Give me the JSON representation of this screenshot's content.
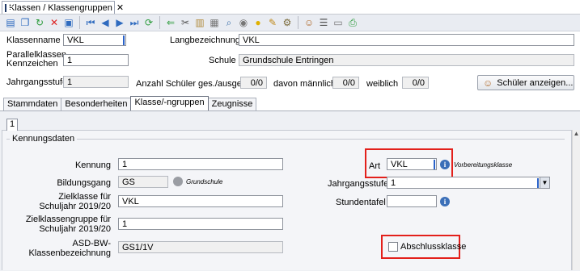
{
  "window_tab": {
    "title": "Klassen / Klassengruppen",
    "close": "✕"
  },
  "toolbar": {
    "icons": [
      "new-icon",
      "copy-icon",
      "refresh-icon",
      "delete-icon",
      "save-icon",
      "first-icon",
      "prev-icon",
      "next-icon",
      "last-icon",
      "reload-icon",
      "back-icon",
      "cut-icon",
      "paste-icon",
      "clipboard-icon",
      "find-icon",
      "eye-icon",
      "bulb-icon",
      "brush-icon",
      "gear-icon",
      "people-icon",
      "list-icon",
      "document-icon",
      "print-icon"
    ]
  },
  "header": {
    "klassenname_label": "Klassenname",
    "klassenname_value": "VKL",
    "langbezeichnung_label": "Langbezeichnung",
    "langbezeichnung_value": "VKL",
    "parallel_label_1": "Parallelklassen",
    "parallel_label_2": "Kennzeichen",
    "parallel_value": "1",
    "schule_label": "Schule",
    "schule_value": "Grundschule Entringen",
    "jahrgangsstufe_label": "Jahrgangsstufe",
    "jahrgangsstufe_value": "1",
    "anzahl_label": "Anzahl Schüler ges./ausgetr.",
    "anzahl_value": "0/0",
    "maennlich_label": "davon männlich",
    "maennlich_value": "0/0",
    "weiblich_label": "weiblich",
    "weiblich_value": "0/0",
    "schueler_button": "Schüler anzeigen..."
  },
  "tabs": [
    "Stammdaten",
    "Besonderheiten",
    "Klasse/-ngruppen",
    "Zeugnisse"
  ],
  "active_tab": 2,
  "subtab": "1",
  "group": {
    "title": "Kennungsdaten",
    "kennung_label": "Kennung",
    "kennung_value": "1",
    "bildungsgang_label": "Bildungsgang",
    "bildungsgang_value": "GS",
    "bildungsgang_hint": "Grundschule",
    "zielklasse_label_1": "Zielklasse für",
    "zielklasse_label_2": "Schuljahr 2019/20",
    "zielklasse_value": "VKL",
    "zielgruppe_label_1": "Zielklassengruppe für",
    "zielgruppe_label_2": "Schuljahr 2019/20",
    "zielgruppe_value": "1",
    "asd_label_1": "ASD-BW-",
    "asd_label_2": "Klassenbezeichnung",
    "asd_value": "GS1/1V",
    "art_label": "Art",
    "art_value": "VKL",
    "art_hint": "Vorbereitungsklasse",
    "jahrgangsstufe_label": "Jahrgangsstufe",
    "jahrgangsstufe_value": "1",
    "stundentafel_label": "Stundentafel",
    "stundentafel_value": "",
    "abschluss_label": "Abschlussklasse",
    "abschluss_checked": false
  },
  "colors": {
    "highlight": "#e3201b",
    "info": "#3b6fb8",
    "toolbar": "#e9ecf2"
  }
}
